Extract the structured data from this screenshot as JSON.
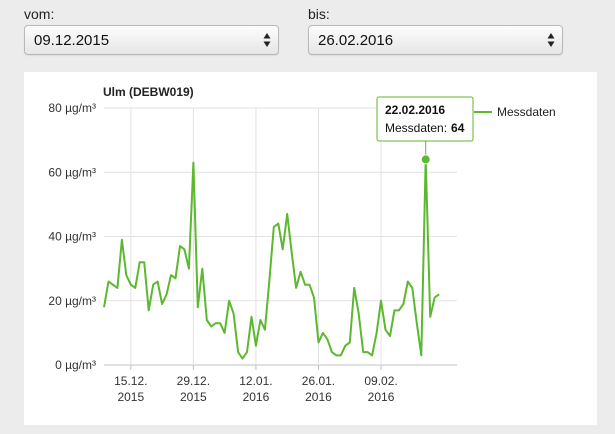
{
  "form": {
    "from_label": "vom:",
    "from_value": "09.12.2015",
    "to_label": "bis:",
    "to_value": "26.02.2016"
  },
  "chart_data": {
    "type": "line",
    "title": "Ulm (DEBW019)",
    "y_unit": "µg/m³",
    "ylim": [
      0,
      80
    ],
    "y_ticks": [
      0,
      20,
      40,
      60,
      80
    ],
    "y_tick_labels": [
      "0 µg/m³",
      "20 µg/m³",
      "40 µg/m³",
      "60 µg/m³",
      "80 µg/m³"
    ],
    "x_tick_dates": [
      "2015-12-15",
      "2015-12-29",
      "2016-01-12",
      "2016-01-26",
      "2016-02-09"
    ],
    "x_tick_labels": [
      [
        "15.12.",
        "2015"
      ],
      [
        "29.12.",
        "2015"
      ],
      [
        "12.01.",
        "2016"
      ],
      [
        "26.01.",
        "2016"
      ],
      [
        "09.02.",
        "2016"
      ]
    ],
    "xlim": [
      "2015-12-09",
      "2016-02-26"
    ],
    "grid": true,
    "legend_position": "top-right",
    "series": [
      {
        "name": "Messdaten",
        "color": "#5cb82e",
        "points": [
          [
            "2015-12-09",
            18
          ],
          [
            "2015-12-10",
            26
          ],
          [
            "2015-12-11",
            25
          ],
          [
            "2015-12-12",
            24
          ],
          [
            "2015-12-13",
            39
          ],
          [
            "2015-12-14",
            28
          ],
          [
            "2015-12-15",
            25
          ],
          [
            "2015-12-16",
            24
          ],
          [
            "2015-12-17",
            32
          ],
          [
            "2015-12-18",
            32
          ],
          [
            "2015-12-19",
            17
          ],
          [
            "2015-12-20",
            25
          ],
          [
            "2015-12-21",
            26
          ],
          [
            "2015-12-22",
            19
          ],
          [
            "2015-12-23",
            22
          ],
          [
            "2015-12-24",
            28
          ],
          [
            "2015-12-25",
            27
          ],
          [
            "2015-12-26",
            37
          ],
          [
            "2015-12-27",
            36
          ],
          [
            "2015-12-28",
            30
          ],
          [
            "2015-12-29",
            63
          ],
          [
            "2015-12-30",
            18
          ],
          [
            "2015-12-31",
            30
          ],
          [
            "2016-01-01",
            14
          ],
          [
            "2016-01-02",
            12
          ],
          [
            "2016-01-03",
            13
          ],
          [
            "2016-01-04",
            13
          ],
          [
            "2016-01-05",
            10
          ],
          [
            "2016-01-06",
            20
          ],
          [
            "2016-01-07",
            16
          ],
          [
            "2016-01-08",
            4
          ],
          [
            "2016-01-09",
            2
          ],
          [
            "2016-01-10",
            4
          ],
          [
            "2016-01-11",
            15
          ],
          [
            "2016-01-12",
            6
          ],
          [
            "2016-01-13",
            14
          ],
          [
            "2016-01-14",
            11
          ],
          [
            "2016-01-15",
            26
          ],
          [
            "2016-01-16",
            43
          ],
          [
            "2016-01-17",
            44
          ],
          [
            "2016-01-18",
            36
          ],
          [
            "2016-01-19",
            47
          ],
          [
            "2016-01-20",
            35
          ],
          [
            "2016-01-21",
            24
          ],
          [
            "2016-01-22",
            29
          ],
          [
            "2016-01-23",
            25
          ],
          [
            "2016-01-24",
            25
          ],
          [
            "2016-01-25",
            21
          ],
          [
            "2016-01-26",
            7
          ],
          [
            "2016-01-27",
            10
          ],
          [
            "2016-01-28",
            8
          ],
          [
            "2016-01-29",
            4
          ],
          [
            "2016-01-30",
            3
          ],
          [
            "2016-01-31",
            3
          ],
          [
            "2016-02-01",
            6
          ],
          [
            "2016-02-02",
            7
          ],
          [
            "2016-02-03",
            24
          ],
          [
            "2016-02-04",
            16
          ],
          [
            "2016-02-05",
            4
          ],
          [
            "2016-02-06",
            4
          ],
          [
            "2016-02-07",
            3
          ],
          [
            "2016-02-08",
            10
          ],
          [
            "2016-02-09",
            20
          ],
          [
            "2016-02-10",
            11
          ],
          [
            "2016-02-11",
            9
          ],
          [
            "2016-02-12",
            17
          ],
          [
            "2016-02-13",
            17
          ],
          [
            "2016-02-14",
            19
          ],
          [
            "2016-02-15",
            26
          ],
          [
            "2016-02-16",
            24
          ],
          [
            "2016-02-17",
            13
          ],
          [
            "2016-02-18",
            3
          ],
          [
            "2016-02-19",
            64
          ],
          [
            "2016-02-20",
            15
          ],
          [
            "2016-02-21",
            21
          ],
          [
            "2016-02-22",
            22
          ]
        ]
      }
    ],
    "tooltip": {
      "date": "22.02.2016",
      "label": "Messdaten:",
      "value": "64",
      "point": [
        "2016-02-19",
        64
      ]
    }
  }
}
